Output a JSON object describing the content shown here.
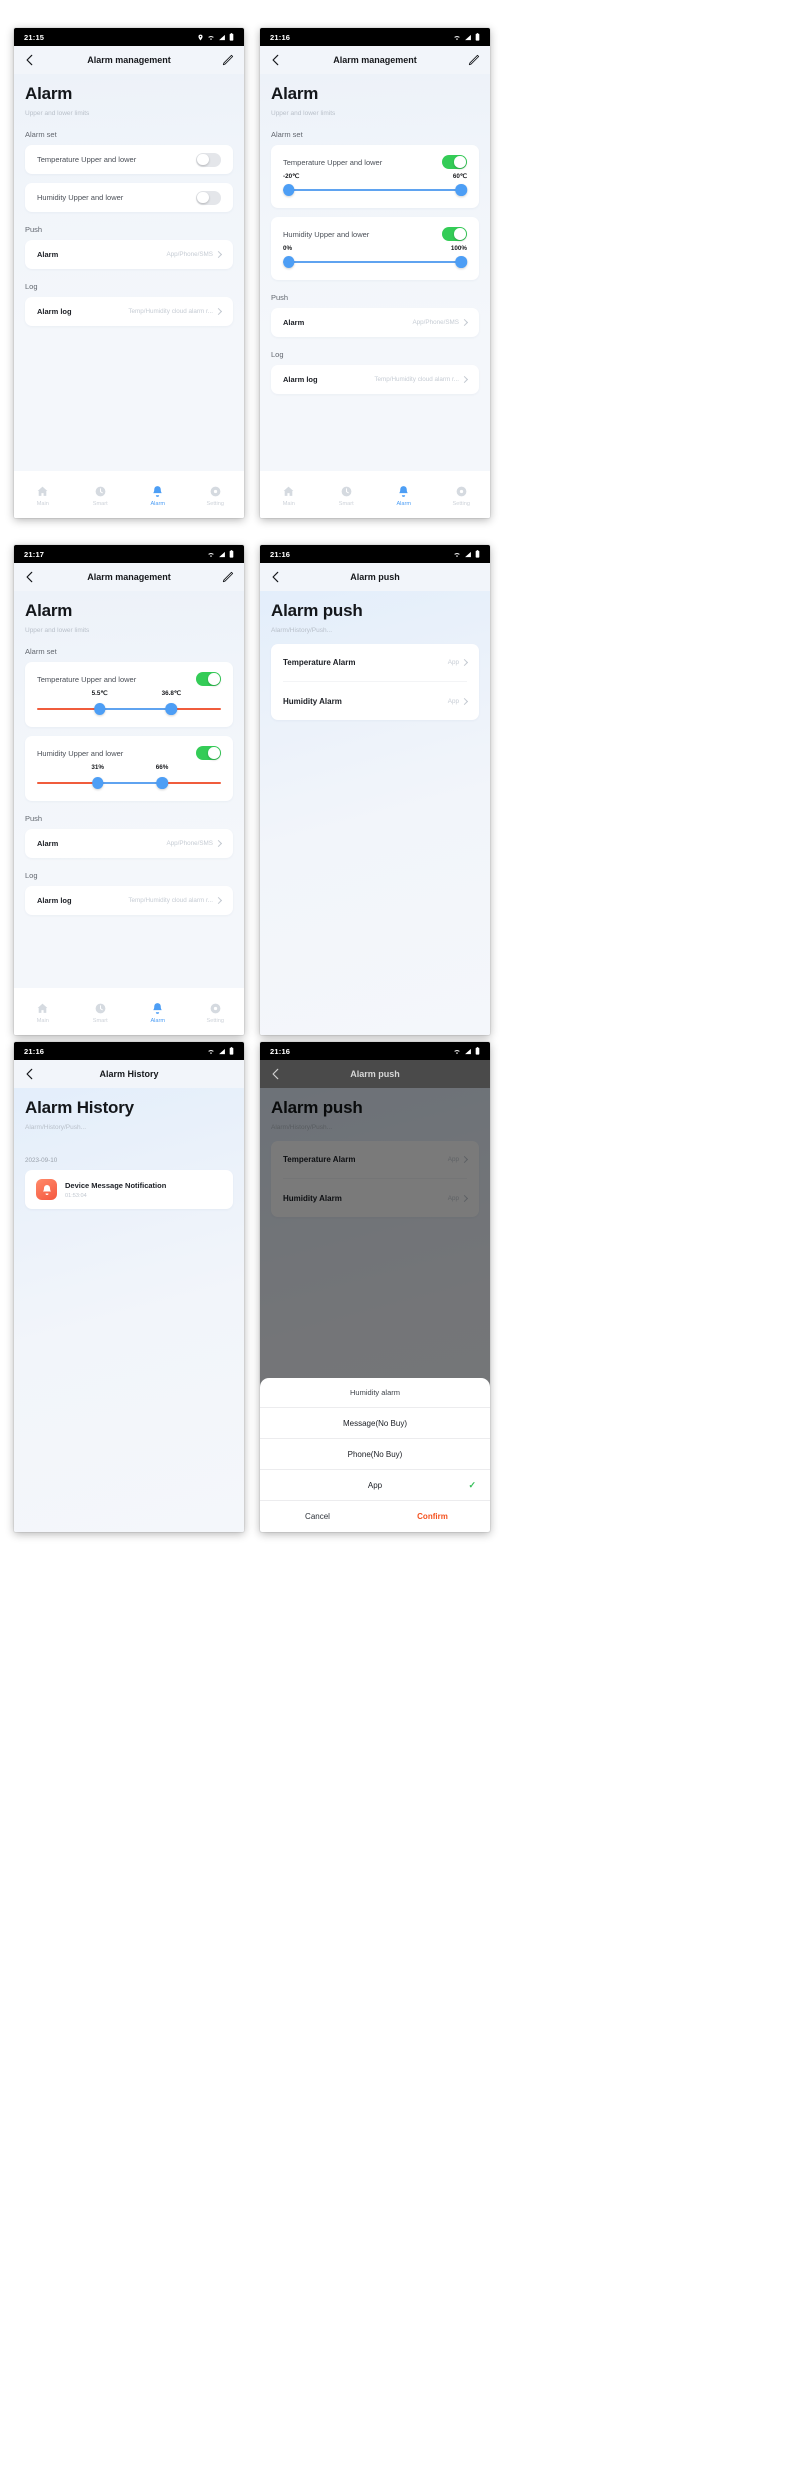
{
  "panels": [
    {
      "id": "alarm-management-off",
      "status_time": "21:15",
      "nav_title": "Alarm management",
      "title": "Alarm",
      "subtitle": "Upper and lower limits",
      "section_alarm_set": "Alarm set",
      "temp_label": "Temperature Upper and lower",
      "temp_on": false,
      "hum_label": "Humidity Upper and lower",
      "hum_on": false,
      "section_push": "Push",
      "push_label": "Alarm",
      "push_value": "App/Phone/SMS",
      "section_log": "Log",
      "log_label": "Alarm log",
      "log_value": "Temp/Humidity cloud alarm r..."
    },
    {
      "id": "alarm-management-on-default",
      "status_time": "21:16",
      "nav_title": "Alarm management",
      "title": "Alarm",
      "subtitle": "Upper and lower limits",
      "section_alarm_set": "Alarm set",
      "temp_label": "Temperature Upper and lower",
      "temp_on": true,
      "temp_min": "-20℃",
      "temp_max": "60℃",
      "hum_label": "Humidity Upper and lower",
      "hum_on": true,
      "hum_min": "0%",
      "hum_max": "100%",
      "section_push": "Push",
      "push_label": "Alarm",
      "push_value": "App/Phone/SMS",
      "section_log": "Log",
      "log_label": "Alarm log",
      "log_value": "Temp/Humidity cloud alarm r..."
    },
    {
      "id": "alarm-management-on-custom",
      "status_time": "21:17",
      "nav_title": "Alarm management",
      "title": "Alarm",
      "subtitle": "Upper and lower limits",
      "section_alarm_set": "Alarm set",
      "temp_label": "Temperature Upper and lower",
      "temp_on": true,
      "temp_min": "5.5℃",
      "temp_max": "36.8℃",
      "hum_label": "Humidity Upper and lower",
      "hum_on": true,
      "hum_min": "31%",
      "hum_max": "66%",
      "section_push": "Push",
      "push_label": "Alarm",
      "push_value": "App/Phone/SMS",
      "section_log": "Log",
      "log_label": "Alarm log",
      "log_value": "Temp/Humidity cloud alarm r..."
    },
    {
      "id": "alarm-push",
      "status_time": "21:16",
      "nav_title": "Alarm push",
      "title": "Alarm push",
      "subtitle": "Alarm/History/Push...",
      "items": [
        {
          "label": "Temperature Alarm",
          "value": "App"
        },
        {
          "label": "Humidity Alarm",
          "value": "App"
        }
      ]
    },
    {
      "id": "alarm-history",
      "status_time": "21:16",
      "nav_title": "Alarm History",
      "title": "Alarm History",
      "subtitle": "Alarm/History/Push...",
      "date": "2023-09-10",
      "entry_title": "Device Message Notification",
      "entry_time": "01:53:04"
    },
    {
      "id": "alarm-push-sheet",
      "status_time": "21:16",
      "nav_title": "Alarm push",
      "title": "Alarm push",
      "subtitle": "Alarm/History/Push...",
      "items": [
        {
          "label": "Temperature Alarm",
          "value": "App"
        },
        {
          "label": "Humidity Alarm",
          "value": "App"
        }
      ],
      "sheet": {
        "title": "Humidity alarm",
        "options": [
          {
            "label": "Message(No Buy)",
            "selected": false
          },
          {
            "label": "Phone(No Buy)",
            "selected": false
          },
          {
            "label": "App",
            "selected": true
          }
        ],
        "check": "✓",
        "cancel": "Cancel",
        "confirm": "Confirm"
      }
    }
  ],
  "tabbar": {
    "items": [
      {
        "label": "Main",
        "icon": "home-icon",
        "active": false
      },
      {
        "label": "Smart",
        "icon": "clock-icon",
        "active": false
      },
      {
        "label": "Alarm",
        "icon": "bell-icon",
        "active": true
      },
      {
        "label": "Setting",
        "icon": "gear-icon",
        "active": false
      }
    ]
  },
  "colors": {
    "accent_blue": "#4d9ef5",
    "toggle_green": "#34cc57",
    "slider_red": "#f05c3c",
    "confirm_orange": "#f4511e"
  }
}
